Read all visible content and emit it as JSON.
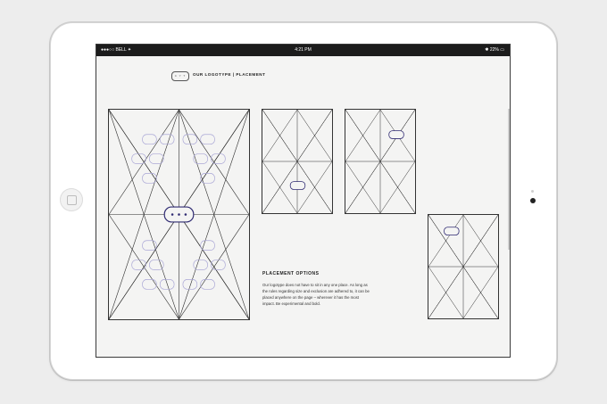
{
  "status_bar": {
    "carrier": "●●●○○ BELL ✦",
    "time": "4:21 PM",
    "battery": "✱ 22% ▭"
  },
  "header": {
    "logo_text": "C Y T",
    "title": "OUR LOGOTYPE | PLACEMENT"
  },
  "placement": {
    "title": "PLACEMENT OPTIONS",
    "body": "Our logotype does not have to sit in any one place. As long as the rules regarding size and exclusion are adhered to, it can be placed anywhere on the page – wherever it has the most impact. Be experimental and bold."
  },
  "colors": {
    "logo_primary": "#2f2a72",
    "logo_faded": "#aaa7d6",
    "grid_lines": "#2a2a2a"
  }
}
